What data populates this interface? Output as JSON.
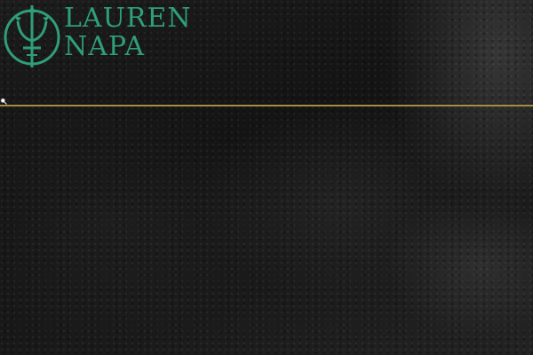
{
  "site": {
    "logo_line1": "LAUREN",
    "logo_line2": "NAPA",
    "logo_emblem": "trident-emblem-icon",
    "brand_color": "#2f9e7a"
  },
  "nav": {
    "items": [
      {
        "label": ""
      },
      {
        "label": ""
      },
      {
        "label": ""
      }
    ]
  },
  "search": {
    "icon": "search-icon"
  },
  "colors": {
    "link": "#2a3cff",
    "divider": "#c9a55a"
  }
}
